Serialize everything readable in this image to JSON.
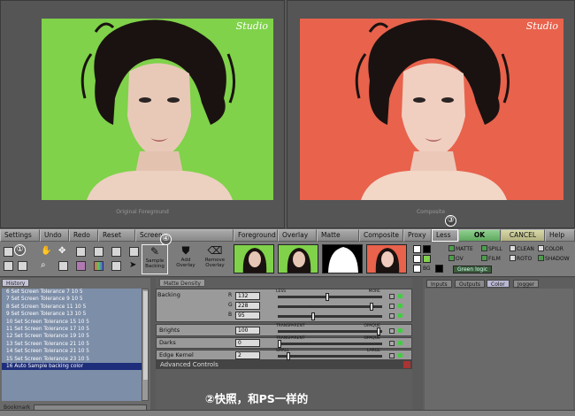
{
  "viewers": {
    "left": {
      "caption": "Original Foreground",
      "watermark": "Studio",
      "background_color": "#7fd24a"
    },
    "right": {
      "caption": "Composite",
      "watermark": "Studio",
      "background_color": "#e8624c"
    }
  },
  "menu": {
    "settings": "Settings",
    "undo": "Undo",
    "redo": "Redo",
    "reset": "Reset",
    "screen": "Screen",
    "foreground": "Foreground",
    "overlay": "Overlay",
    "matte": "Matte",
    "composite": "Composite",
    "proxy": "Proxy",
    "less": "Less",
    "ok": "OK",
    "cancel": "CANCEL",
    "help": "Help"
  },
  "toolbar": {
    "sample_backing": "Sample Backing",
    "add_overlay": "Add Overlay",
    "remove_overlay": "Remove Overlay",
    "green_logic": "Green logic",
    "options": [
      {
        "label": "MATTE",
        "checked": true
      },
      {
        "label": "SPILL",
        "checked": true
      },
      {
        "label": "CLEAN",
        "checked": false
      },
      {
        "label": "COLOR",
        "checked": false
      },
      {
        "label": "OV",
        "checked": true
      },
      {
        "label": "FILM",
        "checked": true
      },
      {
        "label": "ROTO",
        "checked": false
      },
      {
        "label": "SHADOW",
        "checked": true
      }
    ],
    "swatches": [
      "#ffffff",
      "#000000",
      "#ffffff",
      "#7fd24a",
      "#ffffff",
      "#000000"
    ],
    "bg_label": "BG"
  },
  "badges": {
    "one": "①",
    "three": "③",
    "four": "④"
  },
  "history": {
    "tab": "History",
    "items": [
      "6 Set Screen Tolerance  7 10 5",
      "7 Set Screen Tolerance  9 10 5",
      "8 Set Screen Tolerance  11 10 5",
      "9 Set Screen Tolerance  13 10 5",
      "10 Set Screen Tolerance  15 10 5",
      "11 Set Screen Tolerance  17 10 5",
      "12 Set Screen Tolerance  19 10 5",
      "13 Set Screen Tolerance  21 10 5",
      "14 Set Screen Tolerance  21 10 5",
      "15 Set Screen Tolerance  23 10 5",
      "16 Auto Sample backing color"
    ],
    "selected_index": 10,
    "bookmark_label": "Bookmark"
  },
  "controls": {
    "tab": "Matte Density",
    "backing": {
      "label": "Backing",
      "r": "132",
      "g": "228",
      "b": "95",
      "range_low": "LESS",
      "range_high": "MORE"
    },
    "brights": {
      "label": "Brights",
      "value": "100",
      "range_low": "TRANSPARENT",
      "range_high": "OPAQUE"
    },
    "darks": {
      "label": "Darks",
      "value": "0",
      "range_low": "TRANSPARENT",
      "range_high": "OPAQUE"
    },
    "edge_kernel": {
      "label": "Edge Kernel",
      "value": "2",
      "range_low": "SMALL",
      "range_high": "LARGE"
    },
    "advanced": "Advanced Controls",
    "channel_labels": {
      "r": "R",
      "g": "G",
      "b": "B"
    }
  },
  "right_panel": {
    "tabs": [
      "Inputs",
      "Outputs",
      "Color",
      "Jogger"
    ],
    "active_tab": "Color"
  },
  "caption": "②快照，和PS一样的"
}
